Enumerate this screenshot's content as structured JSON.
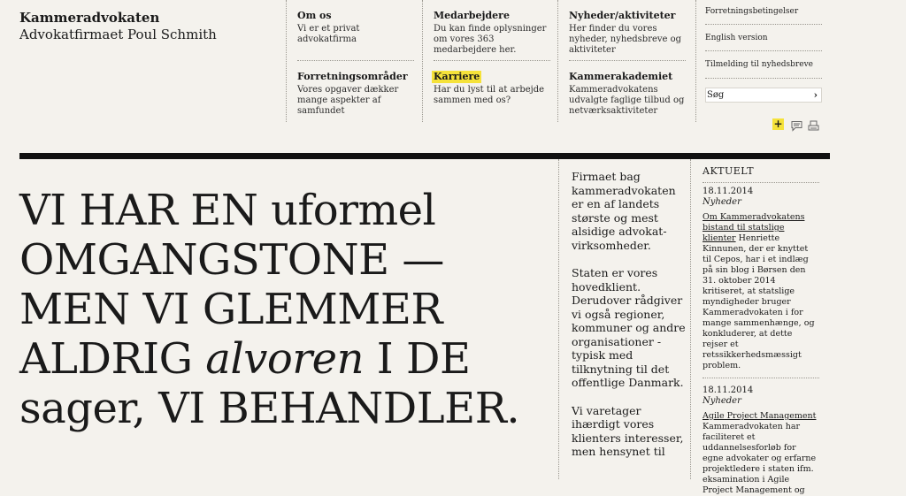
{
  "brand": {
    "name": "Kammeradvokaten",
    "subtitle": "Advokatfirmaet Poul Schmith"
  },
  "menu": {
    "om_os": {
      "title": "Om os",
      "desc": "Vi er et privat advokatfirma"
    },
    "medarbejdere": {
      "title": "Medarbejdere",
      "desc": "Du kan finde oplysninger om vores 363 medarbejdere her."
    },
    "nyheder": {
      "title": "Nyheder/aktiviteter",
      "desc": "Her finder du vores nyheder, nyhedsbreve og aktiviteter"
    },
    "forretning": {
      "title": "Forretningsområder",
      "desc": "Vores opgaver dækker mange aspekter af samfundet"
    },
    "karriere": {
      "title": "Karriere",
      "desc": "Har du lyst til at arbejde sammen med os?"
    },
    "akademi": {
      "title": "Kammerakademiet",
      "desc": "Kammeradvokatens udvalgte faglige tilbud og netværksaktiviteter"
    }
  },
  "utility": {
    "terms": "Forretningsbetingelser",
    "english": "English version",
    "newsletter": "Tilmelding til nyhedsbreve",
    "search_label": "Søg",
    "search_arrow": "›"
  },
  "tools": {
    "plus": "+"
  },
  "headline": {
    "part1": "VI HAR EN uformel OMGANGSTONE — MEN VI GLEMMER ALDRIG ",
    "italic": "alvoren",
    "part2": " I DE sager, VI BEHANDLER."
  },
  "intro": [
    "Firmaet bag kammeradvokaten er en af landets største og mest alsidige advokat-virksomheder.",
    "Staten er vores hovedklient. Derudover rådgiver vi også regioner, kommuner og andre organisationer - typisk med tilknytning til det offentlige Danmark.",
    "Vi varetager ihærdigt vores klienters interesser, men hensynet til"
  ],
  "news": {
    "heading": "AKTUELT",
    "items": [
      {
        "date": "18.11.2014",
        "category": "Nyheder",
        "title": "Om Kammeradvokatens bistand til statslige klienter",
        "body": "Henriette Kinnunen, der er knyttet til Cepos, har i et indlæg på sin blog i Børsen den 31. oktober 2014 kritiseret, at statslige myndigheder bruger Kammeradvokaten i for mange sammenhænge, og konkluderer, at dette rejser et retssikkerhedsmæssigt problem."
      },
      {
        "date": "18.11.2014",
        "category": "Nyheder",
        "title": "Agile Project Management",
        "body": "Kammeradvokaten har faciliteret et uddannelsesforløb for egne advokater og erfarne projektledere i staten ifm. eksamination i Agile Project Management og"
      }
    ]
  }
}
